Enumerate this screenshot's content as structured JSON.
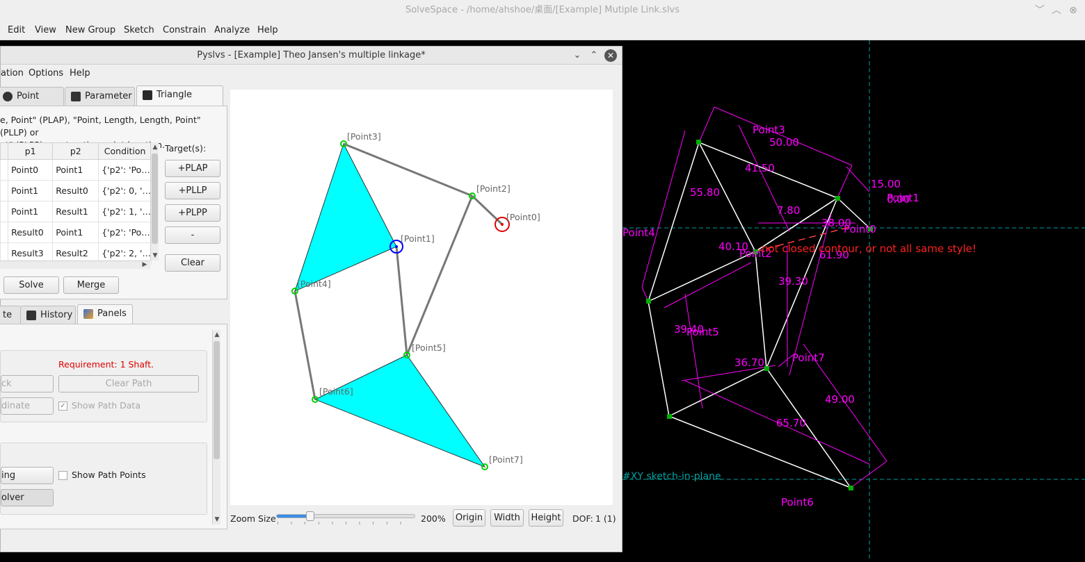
{
  "solvespace": {
    "title": "SolveSpace - /home/ahshoe/桌面/[Example] Mutiple Link.slvs",
    "menu": [
      "Edit",
      "View",
      "New Group",
      "Sketch",
      "Constrain",
      "Analyze",
      "Help"
    ],
    "error_message": "not closed contour, or not all same style!",
    "plane_label": "#XY  sketch-in-plane",
    "point_labels": [
      "Point3",
      "Point4",
      "Point2",
      "Point5",
      "Point7",
      "Point6",
      "Point0",
      "Point1"
    ],
    "dimensions": [
      "50.00",
      "41.50",
      "15.00",
      "0.00",
      "55.80",
      "7.80",
      "38.00",
      "40.10",
      "61.90",
      "39.30",
      "39.40",
      "36.70",
      "49.00",
      "65.70"
    ],
    "colors": {
      "constraint": "#ff00ff",
      "lines": "#ffffff",
      "error": "#ff0000",
      "axis": "#00a0a0"
    }
  },
  "pyslvs": {
    "title": "Pyslvs - [Example] Theo Jansen's multiple linkage*",
    "menu": [
      "ation",
      "Options",
      "Help"
    ],
    "tabs_top": [
      {
        "label": "Point Style",
        "icon": "gear-icon"
      },
      {
        "label": "Parameter",
        "icon": "parameter-icon"
      },
      {
        "label": "Triangle Solver",
        "icon": "triangle-solver-icon"
      }
    ],
    "description": "e, Point\" (PLAP), \"Point, Length, Length, Point\" (PLLP) or nt\" (PLPP) construction point location.",
    "description_line1": "e, Point\" (PLAP), \"Point, Length, Length, Point\" (PLLP) or",
    "description_line2": "nt\" (PLPP) construction point location.",
    "table": {
      "headers": [
        "p1",
        "p2",
        "Condition"
      ],
      "rows": [
        [
          "Point0",
          "Point1",
          "{'p2': 'Po…"
        ],
        [
          "Point1",
          "Result0",
          "{'p2': 0, '…"
        ],
        [
          "Point1",
          "Result1",
          "{'p2': 1, '…"
        ],
        [
          "Result0",
          "Point1",
          "{'p2': 'Po…"
        ],
        [
          "Result3",
          "Result2",
          "{'p2': 2, '…"
        ]
      ]
    },
    "targets_label": "Target(s):",
    "target_buttons": [
      "+PLAP",
      "+PLLP",
      "+PLPP",
      "-"
    ],
    "clear_label": "Clear",
    "solve_label": "Solve",
    "merge_label": "Merge",
    "tabs_bottom": [
      {
        "label": "te"
      },
      {
        "label": "History",
        "icon": "history-icon"
      },
      {
        "label": "Panels",
        "icon": "panels-icon"
      }
    ],
    "requirement": "Requirement: 1 Shaft.",
    "btn_track": "ck",
    "btn_clear_path": "Clear Path",
    "btn_coordinate": "dinate",
    "show_path_data": "Show Path Data",
    "btn_ing": "ing",
    "show_path_points": "Show Path Points",
    "btn_solver": "olver",
    "zoom_label": "Zoom Size",
    "zoom_value": "200%",
    "zoom_fraction": 0.24,
    "origin_label": "Origin",
    "width_label": "Width",
    "height_label": "Height",
    "dof_label": "DOF:",
    "dof_value": "1 (1)",
    "canvas_points": [
      "[Point3]",
      "[Point2]",
      "[Point0]",
      "[Point1]",
      "[Point4]",
      "[Point5]",
      "[Point6]",
      "[Point7]"
    ],
    "colors": {
      "triangle_fill": "#00ffff",
      "point": "#00cc00",
      "shaft": "#ff0000",
      "driver": "#0000ff",
      "requirement": "#e00000"
    }
  }
}
